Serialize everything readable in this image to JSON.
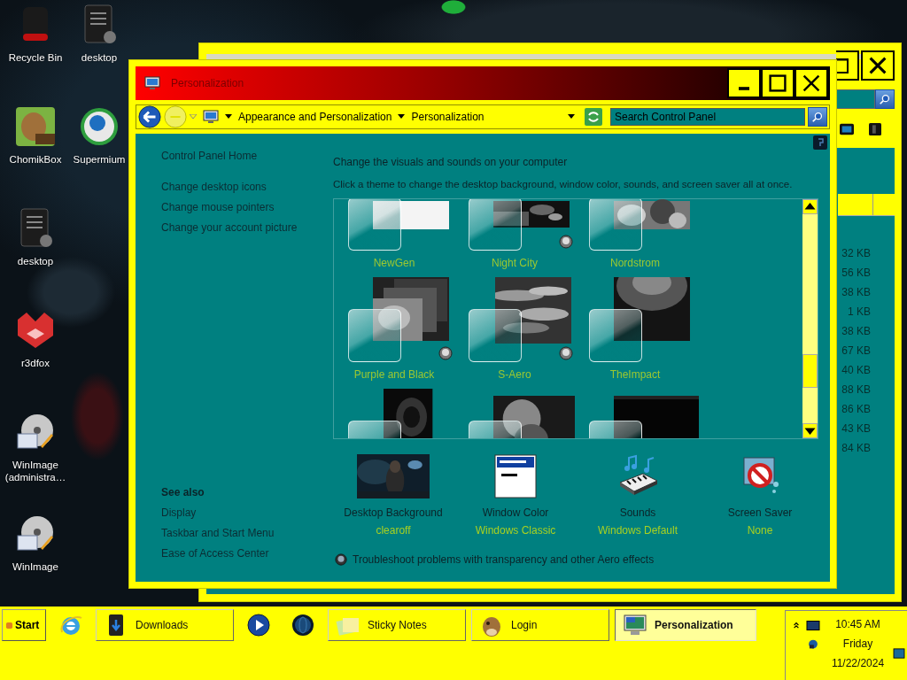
{
  "desktop_icons": [
    {
      "label": "Recycle Bin",
      "kind": "bin"
    },
    {
      "label": "desktop",
      "kind": "doc"
    },
    {
      "label": "ChomikBox",
      "kind": "hamster"
    },
    {
      "label": "Supermium",
      "kind": "browser"
    },
    {
      "label": "desktop",
      "kind": "doc"
    },
    {
      "label": "r3dfox",
      "kind": "fox"
    },
    {
      "label": "WinImage (administra…",
      "kind": "disc"
    },
    {
      "label": "WinImage",
      "kind": "disc"
    }
  ],
  "back_window": {
    "sizes": [
      "32 KB",
      "56 KB",
      "38 KB",
      "1 KB",
      "38 KB",
      "67 KB",
      "40 KB",
      "88 KB",
      "86 KB",
      "43 KB",
      "84 KB"
    ]
  },
  "window": {
    "title": "Personalization"
  },
  "address_bar": {
    "path": [
      "Appearance and Personalization",
      "Personalization"
    ]
  },
  "search": {
    "placeholder": "Search Control Panel"
  },
  "sidebar": {
    "home": "Control Panel Home",
    "links": [
      "Change desktop icons",
      "Change mouse pointers",
      "Change your account picture"
    ],
    "see_also": {
      "title": "See also",
      "links": [
        "Display",
        "Taskbar and Start Menu",
        "Ease of Access Center"
      ]
    }
  },
  "heading": "Change the visuals and sounds on your computer",
  "intro": "Click a theme to change the desktop background, window color, sounds, and screen saver all at once.",
  "themes": [
    {
      "name": "NewGen",
      "badge": false
    },
    {
      "name": "Night City",
      "badge": true
    },
    {
      "name": "Nordstrom",
      "badge": false
    },
    {
      "name": "Purple and Black",
      "badge": true
    },
    {
      "name": "S-Aero",
      "badge": true
    },
    {
      "name": "TheImpact",
      "badge": false
    }
  ],
  "settings": [
    {
      "label": "Desktop Background",
      "value": "clearoff",
      "kind": "background"
    },
    {
      "label": "Window Color",
      "value": "Windows Classic",
      "kind": "color"
    },
    {
      "label": "Sounds",
      "value": "Windows Default",
      "kind": "sounds"
    },
    {
      "label": "Screen Saver",
      "value": "None",
      "kind": "saver"
    }
  ],
  "troubleshoot": "Troubleshoot problems with transparency and other Aero effects",
  "taskbar": {
    "start": "Start",
    "items": [
      {
        "kind": "ie",
        "selected": false
      },
      {
        "kind": "downloads",
        "label": "Downloads",
        "selected": false
      },
      {
        "kind": "media",
        "selected": false
      },
      {
        "kind": "globe",
        "selected": false
      },
      {
        "kind": "notes",
        "label": "Sticky Notes",
        "selected": false
      },
      {
        "kind": "hamster",
        "label": "Login",
        "selected": false
      },
      {
        "kind": "display",
        "label": "Personalization",
        "selected": true
      }
    ],
    "clock": {
      "time": "10:45 AM",
      "day": "Friday",
      "date": "11/22/2024"
    }
  }
}
